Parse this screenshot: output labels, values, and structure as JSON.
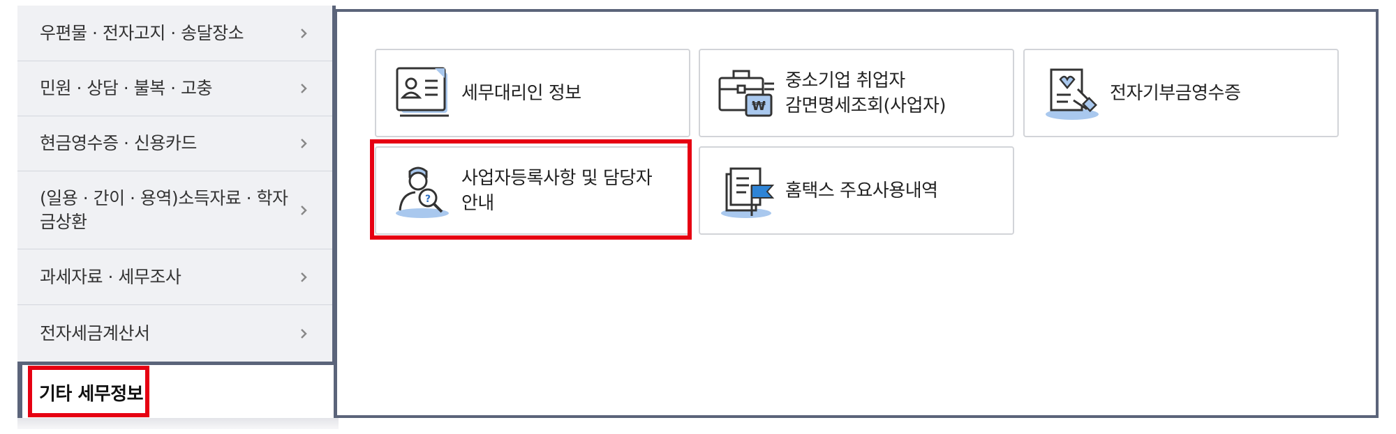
{
  "sidebar": {
    "items": [
      {
        "label": "우편물 · 전자고지 · 송달장소"
      },
      {
        "label": "민원 · 상담 · 불복 · 고충"
      },
      {
        "label": "현금영수증 · 신용카드"
      },
      {
        "label": "(일용 · 간이 · 용역)소득자료 · 학자금상환"
      },
      {
        "label": "과세자료 · 세무조사"
      },
      {
        "label": "전자세금계산서"
      }
    ],
    "active": {
      "label": "기타 세무정보"
    }
  },
  "cards": [
    {
      "label": "세무대리인 정보",
      "icon": "id-card-icon"
    },
    {
      "label": "중소기업 취업자\n감면명세조회(사업자)",
      "icon": "briefcase-won-icon"
    },
    {
      "label": "전자기부금영수증",
      "icon": "donation-receipt-icon"
    },
    {
      "label": "사업자등록사항 및 담당자\n안내",
      "icon": "person-search-icon"
    },
    {
      "label": "홈택스 주요사용내역",
      "icon": "document-flag-icon"
    }
  ],
  "colors": {
    "accent_border": "#5b647a",
    "highlight": "#e60012",
    "icon_blue": "#a9c8ee"
  }
}
